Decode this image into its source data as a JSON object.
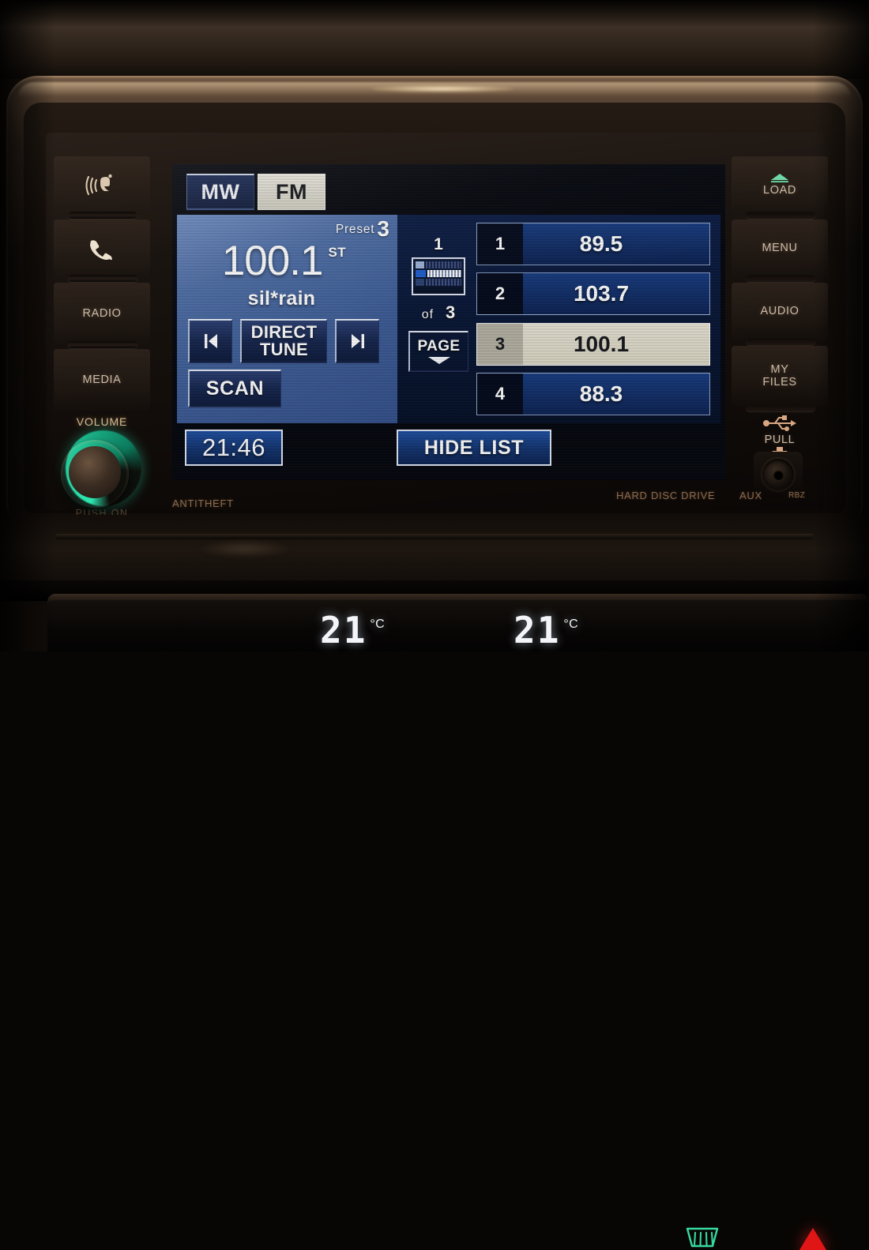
{
  "head_unit": {
    "model_label": "RBZ",
    "faceplate_labels": {
      "antitheft": "ANTITHEFT",
      "hard_disc_drive": "HARD DISC DRIVE",
      "aux": "AUX"
    }
  },
  "left_buttons": [
    {
      "name": "voice-command",
      "label": "",
      "icon": "voice-command-icon"
    },
    {
      "name": "phone",
      "label": "",
      "icon": "phone-icon"
    },
    {
      "name": "radio",
      "label": "RADIO",
      "icon": ""
    },
    {
      "name": "media",
      "label": "MEDIA",
      "icon": ""
    }
  ],
  "volume": {
    "label": "VOLUME",
    "push_label": "PUSH ON",
    "ring_color": "#2ee6b0"
  },
  "right_buttons": [
    {
      "name": "load",
      "label": "LOAD",
      "icon": "eject-icon"
    },
    {
      "name": "menu",
      "label": "MENU",
      "icon": ""
    },
    {
      "name": "audio",
      "label": "AUDIO",
      "icon": ""
    },
    {
      "name": "my-files",
      "label_line1": "MY",
      "label_line2": "FILES",
      "icon": ""
    },
    {
      "name": "usb",
      "label": "PULL",
      "icon": "usb-icon"
    }
  ],
  "screen": {
    "bands": [
      {
        "label": "MW",
        "active": false
      },
      {
        "label": "FM",
        "active": true
      }
    ],
    "tuner": {
      "preset_word": "Preset",
      "preset_number": "3",
      "frequency": "100.1",
      "stereo_indicator": "ST",
      "station_name": "sil*rain"
    },
    "controls": {
      "seek_prev": "seek-previous-icon",
      "direct_tune_line1": "DIRECT",
      "direct_tune_line2": "TUNE",
      "seek_next": "seek-next-icon",
      "scan": "SCAN"
    },
    "pager": {
      "current_page": "1",
      "of_word": "of",
      "total_pages": "3",
      "page_button": "PAGE",
      "chevron": "chevron-down-icon"
    },
    "presets": [
      {
        "number": "1",
        "frequency": "89.5",
        "selected": false
      },
      {
        "number": "2",
        "frequency": "103.7",
        "selected": false
      },
      {
        "number": "3",
        "frequency": "100.1",
        "selected": true
      },
      {
        "number": "4",
        "frequency": "88.3",
        "selected": false
      }
    ],
    "clock": "21:46",
    "hide_list": "HIDE LIST"
  },
  "climate": {
    "left_temp": "21",
    "left_unit": "°C",
    "right_temp": "21",
    "right_unit": "°C",
    "defrost_icon": "rear-defrost-icon",
    "hazard_icon": "hazard-warning-icon",
    "defrost_color": "#35d9a0",
    "hazard_color": "#e01616"
  }
}
